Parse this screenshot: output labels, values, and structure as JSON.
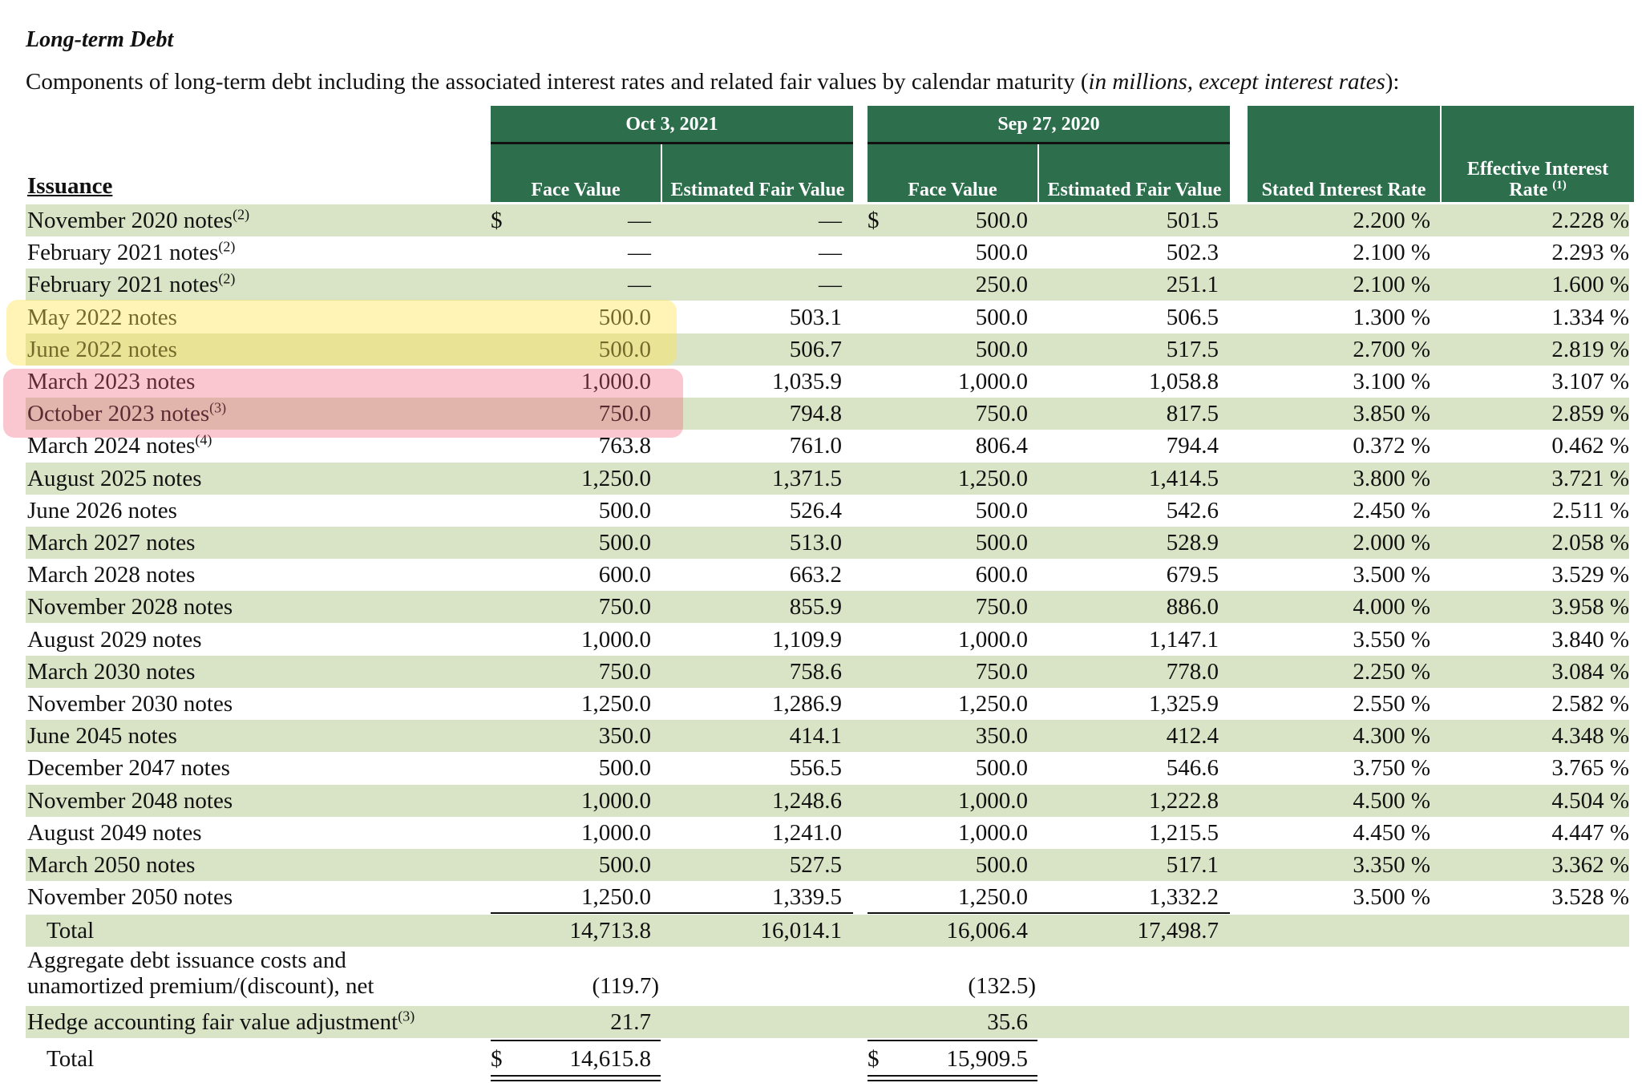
{
  "title": "Long-term Debt",
  "caption": {
    "text": "Components of long-term debt including the associated interest rates and related fair values by calendar maturity (",
    "italic": "in millions, except interest rates",
    "end": "):"
  },
  "header": {
    "issuance": "Issuance",
    "group_2021": "Oct 3, 2021",
    "group_2020": "Sep 27, 2020",
    "face_value": "Face Value",
    "est_fair_value": "Estimated Fair Value",
    "stated_rate": "Stated Interest Rate",
    "effective_rate": "Effective Interest Rate",
    "effective_rate_note": "(1)"
  },
  "currency_symbol": "$",
  "rows": [
    {
      "label": "November 2020 notes",
      "note": "(2)",
      "fv21": "—",
      "ef21": "—",
      "fv20": "500.0",
      "ef20": "501.5",
      "stated": "2.200 %",
      "eff": "2.228 %"
    },
    {
      "label": "February 2021 notes",
      "note": "(2)",
      "fv21": "—",
      "ef21": "—",
      "fv20": "500.0",
      "ef20": "502.3",
      "stated": "2.100 %",
      "eff": "2.293 %"
    },
    {
      "label": "February 2021 notes",
      "note": "(2)",
      "fv21": "—",
      "ef21": "—",
      "fv20": "250.0",
      "ef20": "251.1",
      "stated": "2.100 %",
      "eff": "1.600 %"
    },
    {
      "label": "May 2022 notes",
      "note": "",
      "fv21": "500.0",
      "ef21": "503.1",
      "fv20": "500.0",
      "ef20": "506.5",
      "stated": "1.300 %",
      "eff": "1.334 %"
    },
    {
      "label": "June 2022 notes",
      "note": "",
      "fv21": "500.0",
      "ef21": "506.7",
      "fv20": "500.0",
      "ef20": "517.5",
      "stated": "2.700 %",
      "eff": "2.819 %"
    },
    {
      "label": "March 2023 notes",
      "note": "",
      "fv21": "1,000.0",
      "ef21": "1,035.9",
      "fv20": "1,000.0",
      "ef20": "1,058.8",
      "stated": "3.100 %",
      "eff": "3.107 %"
    },
    {
      "label": "October 2023 notes",
      "note": "(3)",
      "fv21": "750.0",
      "ef21": "794.8",
      "fv20": "750.0",
      "ef20": "817.5",
      "stated": "3.850 %",
      "eff": "2.859 %"
    },
    {
      "label": "March 2024 notes",
      "note": "(4)",
      "fv21": "763.8",
      "ef21": "761.0",
      "fv20": "806.4",
      "ef20": "794.4",
      "stated": "0.372 %",
      "eff": "0.462 %"
    },
    {
      "label": "August 2025 notes",
      "note": "",
      "fv21": "1,250.0",
      "ef21": "1,371.5",
      "fv20": "1,250.0",
      "ef20": "1,414.5",
      "stated": "3.800 %",
      "eff": "3.721 %"
    },
    {
      "label": "June 2026 notes",
      "note": "",
      "fv21": "500.0",
      "ef21": "526.4",
      "fv20": "500.0",
      "ef20": "542.6",
      "stated": "2.450 %",
      "eff": "2.511 %"
    },
    {
      "label": "March 2027 notes",
      "note": "",
      "fv21": "500.0",
      "ef21": "513.0",
      "fv20": "500.0",
      "ef20": "528.9",
      "stated": "2.000 %",
      "eff": "2.058 %"
    },
    {
      "label": "March 2028 notes",
      "note": "",
      "fv21": "600.0",
      "ef21": "663.2",
      "fv20": "600.0",
      "ef20": "679.5",
      "stated": "3.500 %",
      "eff": "3.529 %"
    },
    {
      "label": "November 2028 notes",
      "note": "",
      "fv21": "750.0",
      "ef21": "855.9",
      "fv20": "750.0",
      "ef20": "886.0",
      "stated": "4.000 %",
      "eff": "3.958 %"
    },
    {
      "label": "August 2029 notes",
      "note": "",
      "fv21": "1,000.0",
      "ef21": "1,109.9",
      "fv20": "1,000.0",
      "ef20": "1,147.1",
      "stated": "3.550 %",
      "eff": "3.840 %"
    },
    {
      "label": "March 2030 notes",
      "note": "",
      "fv21": "750.0",
      "ef21": "758.6",
      "fv20": "750.0",
      "ef20": "778.0",
      "stated": "2.250 %",
      "eff": "3.084 %"
    },
    {
      "label": "November 2030 notes",
      "note": "",
      "fv21": "1,250.0",
      "ef21": "1,286.9",
      "fv20": "1,250.0",
      "ef20": "1,325.9",
      "stated": "2.550 %",
      "eff": "2.582 %"
    },
    {
      "label": "June 2045 notes",
      "note": "",
      "fv21": "350.0",
      "ef21": "414.1",
      "fv20": "350.0",
      "ef20": "412.4",
      "stated": "4.300 %",
      "eff": "4.348 %"
    },
    {
      "label": "December 2047 notes",
      "note": "",
      "fv21": "500.0",
      "ef21": "556.5",
      "fv20": "500.0",
      "ef20": "546.6",
      "stated": "3.750 %",
      "eff": "3.765 %"
    },
    {
      "label": "November 2048 notes",
      "note": "",
      "fv21": "1,000.0",
      "ef21": "1,248.6",
      "fv20": "1,000.0",
      "ef20": "1,222.8",
      "stated": "4.500 %",
      "eff": "4.504 %"
    },
    {
      "label": "August 2049 notes",
      "note": "",
      "fv21": "1,000.0",
      "ef21": "1,241.0",
      "fv20": "1,000.0",
      "ef20": "1,215.5",
      "stated": "4.450 %",
      "eff": "4.447 %"
    },
    {
      "label": "March 2050 notes",
      "note": "",
      "fv21": "500.0",
      "ef21": "527.5",
      "fv20": "500.0",
      "ef20": "517.1",
      "stated": "3.350 %",
      "eff": "3.362 %"
    },
    {
      "label": "November 2050 notes",
      "note": "",
      "fv21": "1,250.0",
      "ef21": "1,339.5",
      "fv20": "1,250.0",
      "ef20": "1,332.2",
      "stated": "3.500 %",
      "eff": "3.528 %"
    }
  ],
  "total": {
    "label": "Total",
    "fv21": "14,713.8",
    "ef21": "16,014.1",
    "fv20": "16,006.4",
    "ef20": "17,498.7"
  },
  "aggregate": {
    "label_line1": "Aggregate debt issuance costs and",
    "label_line2": "unamortized premium/(discount), net",
    "fv21": "(119.7)",
    "fv20": "(132.5)"
  },
  "hedge": {
    "label": "Hedge accounting fair value adjustment",
    "note": "(3)",
    "fv21": "21.7",
    "fv20": "35.6"
  },
  "grand_total": {
    "label": "Total",
    "fv21": "14,615.8",
    "fv20": "15,909.5"
  },
  "highlight_colors": {
    "yellow": "#ffe250",
    "red": "#f05a78"
  },
  "header_color": "#2d6e4c",
  "shade_color": "#d9e4c6"
}
